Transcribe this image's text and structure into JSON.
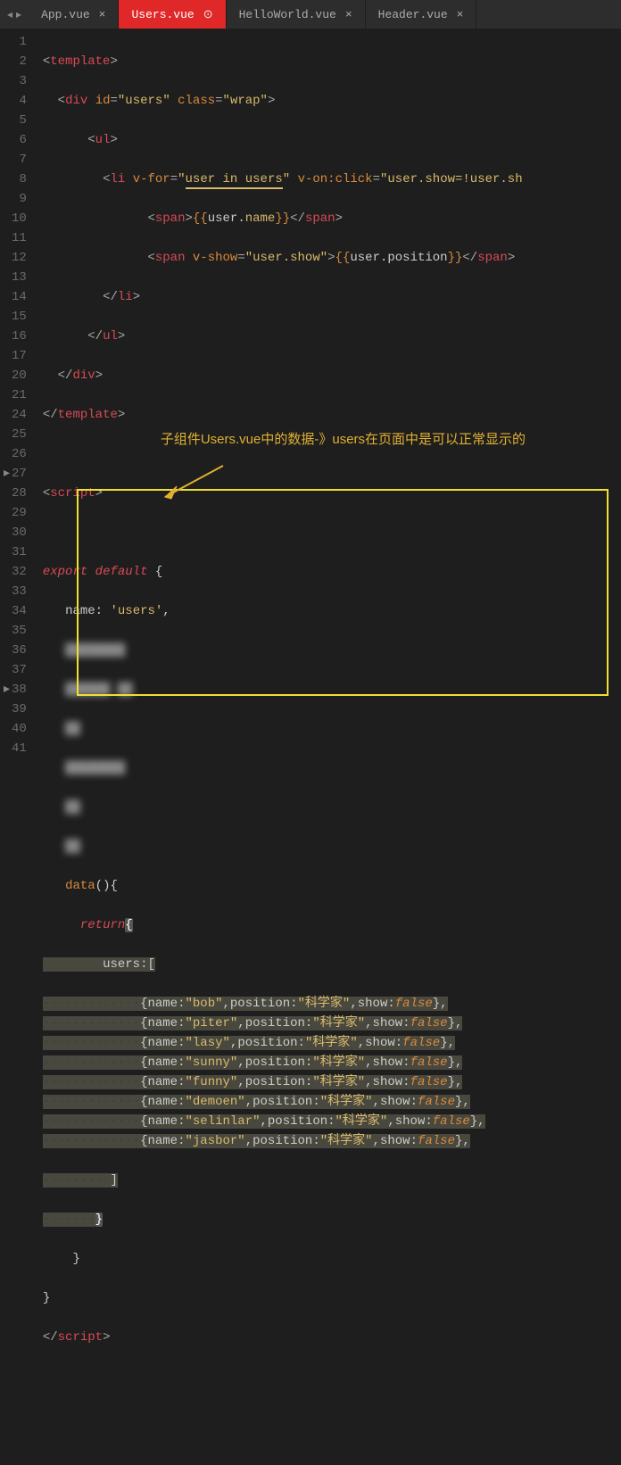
{
  "tabs": {
    "nav_left": "◂",
    "nav_right": "▸",
    "items": [
      {
        "label": "App.vue",
        "close": "×",
        "active": false
      },
      {
        "label": "Users.vue",
        "close": "⊙",
        "active": true
      },
      {
        "label": "HelloWorld.vue",
        "close": "×",
        "active": false
      },
      {
        "label": "Header.vue",
        "close": "×",
        "active": false
      }
    ]
  },
  "line_numbers": [
    "1",
    "2",
    "3",
    "4",
    "5",
    "6",
    "7",
    "8",
    "9",
    "10",
    "11",
    "12",
    "13",
    "14",
    "15",
    "16",
    "17",
    "20",
    "21",
    "24",
    "25",
    "26",
    "27",
    "28",
    "29",
    "30",
    "31",
    "32",
    "33",
    "34",
    "35",
    "36",
    "37",
    "38",
    "39",
    "40",
    "41"
  ],
  "annotation": "子组件Users.vue中的数据-》users在页面中是可以正常显示的",
  "code": {
    "l1": {
      "tag_open": "<",
      "tag": "template",
      "tag_close": ">"
    },
    "l2": {
      "ind": "  ",
      "a": "<",
      "tag": "div",
      "sp": " ",
      "attr1": "id",
      "eq": "=",
      "v1": "\"users\"",
      "sp2": " ",
      "attr2": "class",
      "eq2": "=",
      "v2": "\"wrap\"",
      "c": ">"
    },
    "l3": {
      "ind": "      ",
      "a": "<",
      "tag": "ul",
      "c": ">"
    },
    "l4": {
      "ind": "        ",
      "a": "<",
      "tag": "li",
      "sp": " ",
      "attr1": "v-for",
      "eq": "=",
      "v1a": "\"",
      "v1b": "user",
      "v1c": " in ",
      "v1d": "users",
      "v1e": "\"",
      "sp2": " ",
      "attr2": "v-on:click",
      "eq2": "=",
      "v2": "\"user.show=!user.sh"
    },
    "l5": {
      "ind": "              ",
      "a": "<",
      "tag": "span",
      "c": ">",
      "t1": "{{",
      "t2": "user",
      "t3": ".",
      "t4": "name",
      "t5": "}}",
      "a2": "</",
      "tag2": "span",
      "c2": ">"
    },
    "l6": {
      "ind": "              ",
      "a": "<",
      "tag": "span",
      "sp": " ",
      "attr": "v-show",
      "eq": "=",
      "v": "\"user.show\"",
      "c": ">",
      "t1": "{{",
      "t2": "user",
      "t3": ".",
      "t4": "position",
      "t5": "}}",
      "a2": "</",
      "tag2": "span",
      "c2": ">"
    },
    "l7": {
      "ind": "        ",
      "a": "</",
      "tag": "li",
      "c": ">"
    },
    "l8": {
      "ind": "      ",
      "a": "</",
      "tag": "ul",
      "c": ">"
    },
    "l9": {
      "ind": "  ",
      "a": "</",
      "tag": "div",
      "c": ">"
    },
    "l10": {
      "a": "</",
      "tag": "template",
      "c": ">"
    },
    "l12": {
      "a": "<",
      "tag": "script",
      "c": ">"
    },
    "l14": {
      "kw": "export",
      "sp": " ",
      "kw2": "default",
      "sp2": " ",
      "b": "{"
    },
    "l15": {
      "ind": "   ",
      "p": "name",
      "c": ":",
      "sp": " ",
      "v": "'users'",
      "cm": ","
    },
    "l26": {
      "ind": "   ",
      "p": "data",
      "pa": "()",
      "b": "{"
    },
    "l27": {
      "ind": "     ",
      "kw": "return",
      "b": "{"
    },
    "l28": {
      "ind": "        ",
      "p": "users",
      "c": ":",
      "b": "["
    },
    "data_rows": [
      {
        "name": "\"bob\"",
        "pos": "\"科学家\""
      },
      {
        "name": "\"piter\"",
        "pos": "\"科学家\""
      },
      {
        "name": "\"lasy\"",
        "pos": "\"科学家\""
      },
      {
        "name": "\"sunny\"",
        "pos": "\"科学家\""
      },
      {
        "name": "\"funny\"",
        "pos": "\"科学家\""
      },
      {
        "name": "\"demoen\"",
        "pos": "\"科学家\""
      },
      {
        "name": "\"selinlar\"",
        "pos": "\"科学家\""
      },
      {
        "name": "\"jasbor\"",
        "pos": "\"科学家\""
      }
    ],
    "row_labels": {
      "name": "name",
      "pos": "position",
      "show": "show",
      "false": "false",
      "dots": "·········",
      "dots2": "·······"
    },
    "l37": {
      "ind": "        ",
      "b": "]"
    },
    "l38": {
      "ind": "      ",
      "b": "}"
    },
    "l39": {
      "ind": "    ",
      "b": "}"
    },
    "l40": {
      "b": "}"
    },
    "l41": {
      "a": "</",
      "tag": "script",
      "c": ">"
    }
  }
}
